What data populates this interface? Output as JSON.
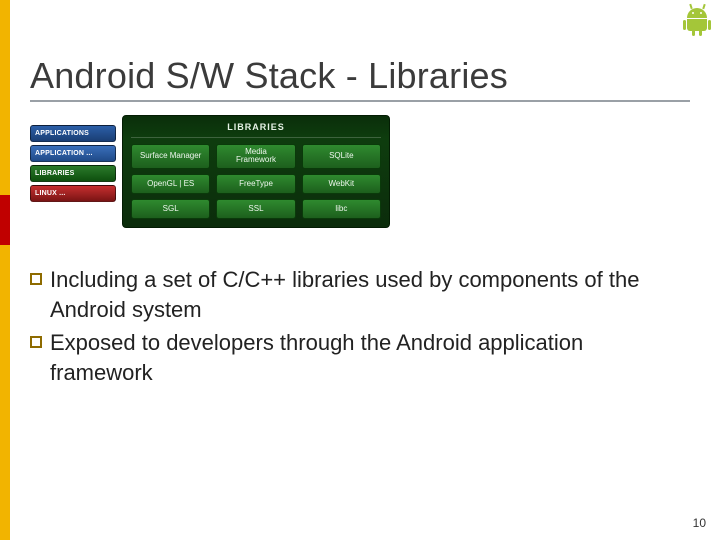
{
  "title": "Android S/W Stack - Libraries",
  "stack_labels": {
    "applications": "APPLICATIONS",
    "framework": "APPLICATION ...",
    "libraries": "LIBRARIES",
    "linux": "LINUX ..."
  },
  "libraries_panel": {
    "title": "LIBRARIES",
    "items": [
      "Surface Manager",
      "Media\nFramework",
      "SQLite",
      "OpenGL | ES",
      "FreeType",
      "WebKit",
      "SGL",
      "SSL",
      "libc"
    ]
  },
  "bullets": [
    "Including a set of C/C++ libraries used by components of the Android system",
    "Exposed to developers through the Android application framework"
  ],
  "page_number": "10"
}
